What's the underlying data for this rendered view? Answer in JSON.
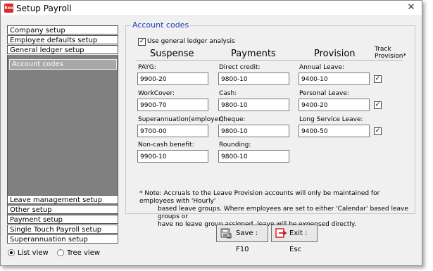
{
  "window": {
    "title": "Setup Payroll",
    "icon_text": "Exo",
    "close_glyph": "✕"
  },
  "sidebar": {
    "top_items": [
      "Company setup",
      "Employee defaults setup",
      "General ledger setup"
    ],
    "selected_item": "Account codes",
    "bottom_items": [
      "Leave management setup",
      "Other setup",
      "Payment setup",
      "Single Touch Payroll setup",
      "Superannuation setup"
    ]
  },
  "view": {
    "list_label": "List view",
    "tree_label": "Tree view",
    "selected": "list"
  },
  "account_codes": {
    "legend": "Account codes",
    "use_gl_label": "Use general ledger analysis",
    "use_gl_checked": true,
    "columns": {
      "suspense": "Suspense",
      "payments": "Payments",
      "provision": "Provision",
      "track_line1": "Track",
      "track_line2": "Provision*"
    },
    "suspense": [
      {
        "label": "PAYG:",
        "value": "9900-20"
      },
      {
        "label": "WorkCover:",
        "value": "9900-70"
      },
      {
        "label": "Superannuation(employer):",
        "value": "9700-00"
      },
      {
        "label": "Non-cash benefit:",
        "value": "9900-10"
      }
    ],
    "payments": [
      {
        "label": "Direct credit:",
        "value": "9800-10"
      },
      {
        "label": "Cash:",
        "value": "9800-10"
      },
      {
        "label": "Cheque:",
        "value": "9800-10"
      },
      {
        "label": "Rounding:",
        "value": "9800-10"
      }
    ],
    "provision": [
      {
        "label": "Annual Leave:",
        "value": "9400-10",
        "track": true
      },
      {
        "label": "Personal Leave:",
        "value": "9400-20",
        "track": true
      },
      {
        "label": "Long Service Leave:",
        "value": "9400-50",
        "track": true
      }
    ],
    "note_lines": [
      "* Note: Accruals to the Leave Provision accounts will only be maintained for employees with 'Hourly'",
      "based leave groups.  Where employees are set to either 'Calendar' based leave groups or",
      "have no leave group assigned, leave will be expensed directly."
    ]
  },
  "buttons": {
    "save": "Save : F10",
    "exit": "Exit : Esc"
  },
  "colors": {
    "legend_blue": "#1a3fb5",
    "sidebar_panel": "#808080",
    "exit_red": "#d01818"
  }
}
